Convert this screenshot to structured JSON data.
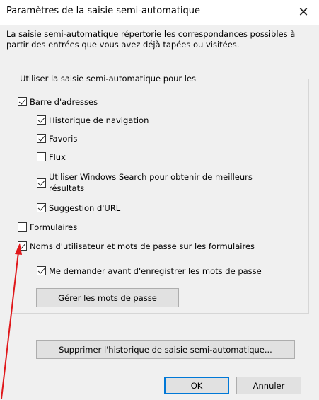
{
  "dialog": {
    "title": "Paramètres de la saisie semi-automatique",
    "close_glyph": "✕"
  },
  "description": "La saisie semi-automatique répertorie les correspondances possibles à partir des entrées que vous avez déjà tapées ou visitées.",
  "group": {
    "legend": "Utiliser la saisie semi-automatique pour les"
  },
  "options": {
    "address_bar": {
      "label": "Barre d'adresses",
      "checked": true
    },
    "history": {
      "label": "Historique de navigation",
      "checked": true
    },
    "favorites": {
      "label": "Favoris",
      "checked": true
    },
    "feeds": {
      "label": "Flux",
      "checked": false
    },
    "windows_search": {
      "label": "Utiliser Windows Search pour obtenir de meilleurs résultats",
      "checked": true
    },
    "url_suggestion": {
      "label": "Suggestion d'URL",
      "checked": true
    },
    "forms": {
      "label": "Formulaires",
      "checked": false
    },
    "usernames_passwords": {
      "label": "Noms d'utilisateur et mots de passe sur les formulaires",
      "checked": true
    },
    "ask_before_saving": {
      "label": "Me demander avant d'enregistrer les mots de passe",
      "checked": true
    }
  },
  "buttons": {
    "manage_passwords": "Gérer les mots de passe",
    "delete_history": "Supprimer l'historique de saisie semi-automatique...",
    "ok": "OK",
    "cancel": "Annuler"
  },
  "annotation": {
    "arrow_color": "#e0181b"
  }
}
